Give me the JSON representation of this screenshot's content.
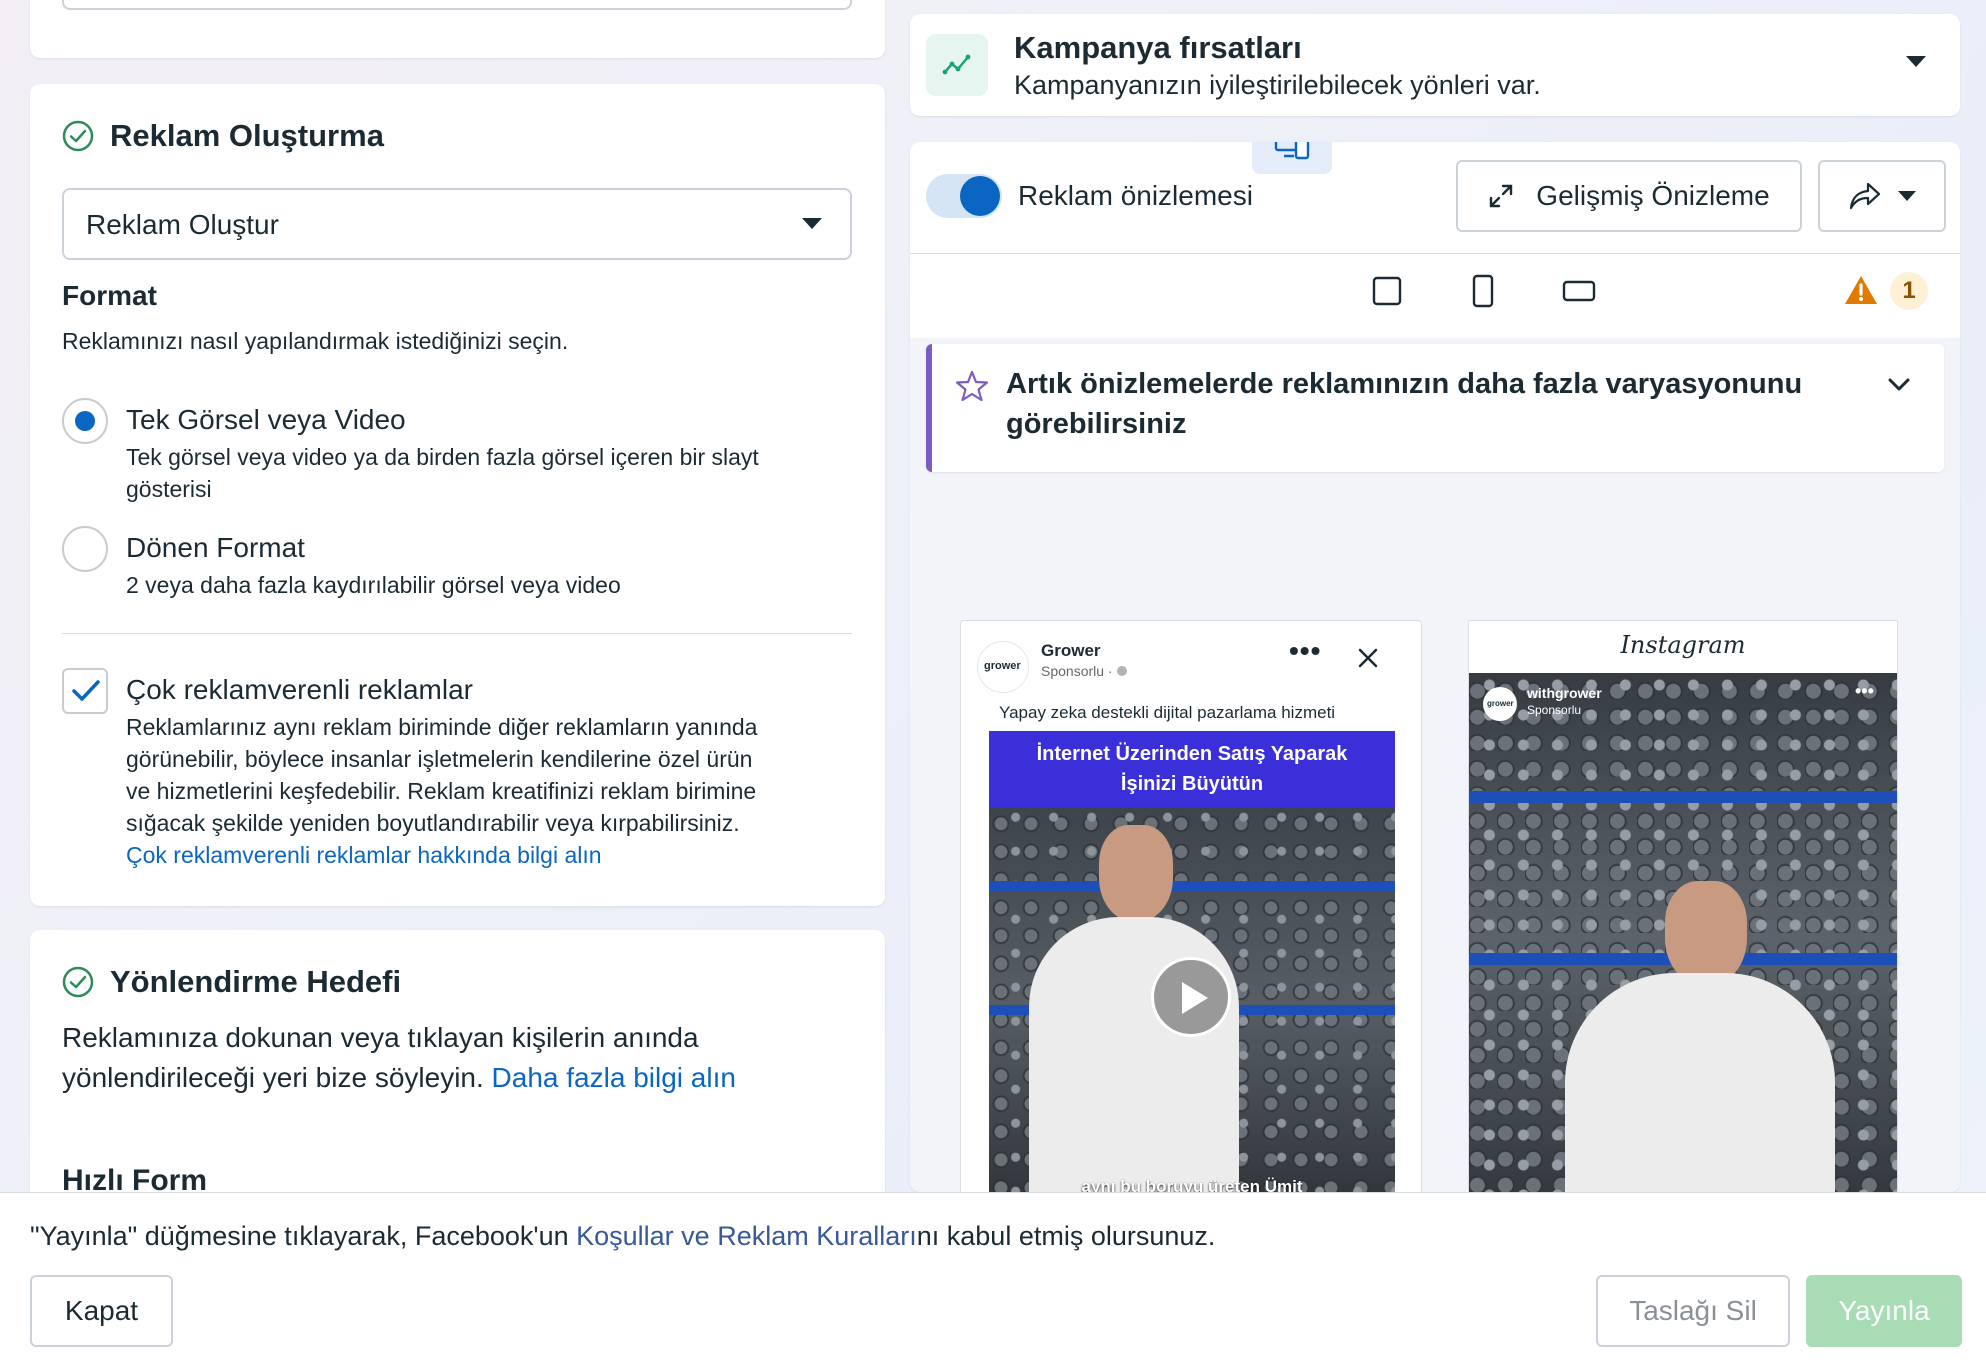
{
  "left": {
    "reklam_olusturma": {
      "title": "Reklam Oluşturma",
      "select_value": "Reklam Oluştur",
      "format_title": "Format",
      "format_desc": "Reklamınızı nasıl yapılandırmak istediğinizi seçin.",
      "option1_label": "Tek Görsel veya Video",
      "option1_desc_line1": "Tek görsel veya video ya da birden fazla görsel içeren bir slayt",
      "option1_desc_line2": "gösterisi",
      "option2_label": "Dönen Format",
      "option2_desc": "2 veya daha fazla kaydırılabilir görsel veya video",
      "multi_label": "Çok reklamverenli reklamlar",
      "multi_desc_line1": "Reklamlarınız aynı reklam biriminde diğer reklamların yanında",
      "multi_desc_line2": "görünebilir, böylece insanlar işletmelerin kendilerine özel ürün",
      "multi_desc_line3": "ve hizmetlerini keşfedebilir. Reklam kreatifinizi reklam birimine",
      "multi_desc_line4": "sığacak şekilde yeniden boyutlandırabilir veya kırpabilirsiniz.",
      "multi_link": "Çok reklamverenli reklamlar hakkında bilgi alın"
    },
    "yonlendirme": {
      "title": "Yönlendirme Hedefi",
      "desc_line1": "Reklamınıza dokunan veya tıklayan kişilerin anında",
      "desc_line2": "yönlendirileceği yeri bize söyleyin.",
      "link": "Daha fazla bilgi alın",
      "hizli_form": "Hızlı Form"
    }
  },
  "right": {
    "opportunities": {
      "title": "Kampanya fırsatları",
      "subtitle": "Kampanyanızın iyileştirilebilecek yönleri var."
    },
    "preview": {
      "toggle_label": "Reklam önizlemesi",
      "advanced_button": "Gelişmiş Önizleme",
      "warning_count": "1",
      "banner_line1": "Artık önizlemelerde reklamınızın daha fazla varyasyonunu",
      "banner_line2": "görebilirsiniz"
    },
    "facebook_ad": {
      "logo_text": "grower",
      "page_name": "Grower",
      "sponsored": "Sponsorlu · ",
      "primary_text": "Yapay zeka destekli dijital pazarlama hizmeti",
      "headline_line1": "İnternet Üzerinden Satış Yaparak",
      "headline_line2": "İşinizi Büyütün",
      "caption": "aynı bu boruyu üreten Ümit"
    },
    "instagram_ad": {
      "brand": "Instagram",
      "avatar_text": "grower",
      "account": "withgrower",
      "sponsored": "Sponsorlu"
    }
  },
  "footer": {
    "terms_prefix": "\"Yayınla\" düğmesine tıklayarak, Facebook'un ",
    "terms_link": "Koşullar ve Reklam Kuralları",
    "terms_suffix": "nı kabul etmiş olursunuz.",
    "close_button": "Kapat",
    "delete_draft_button": "Taslağı Sil",
    "publish_button": "Yayınla"
  },
  "colors": {
    "accent": "#0a66c2",
    "success": "#2e8b57",
    "publish_disabled": "#a8dcb5",
    "banner_border": "#7c5cc4",
    "warning": "#e07b00",
    "headline_band": "#3a2fd9"
  }
}
